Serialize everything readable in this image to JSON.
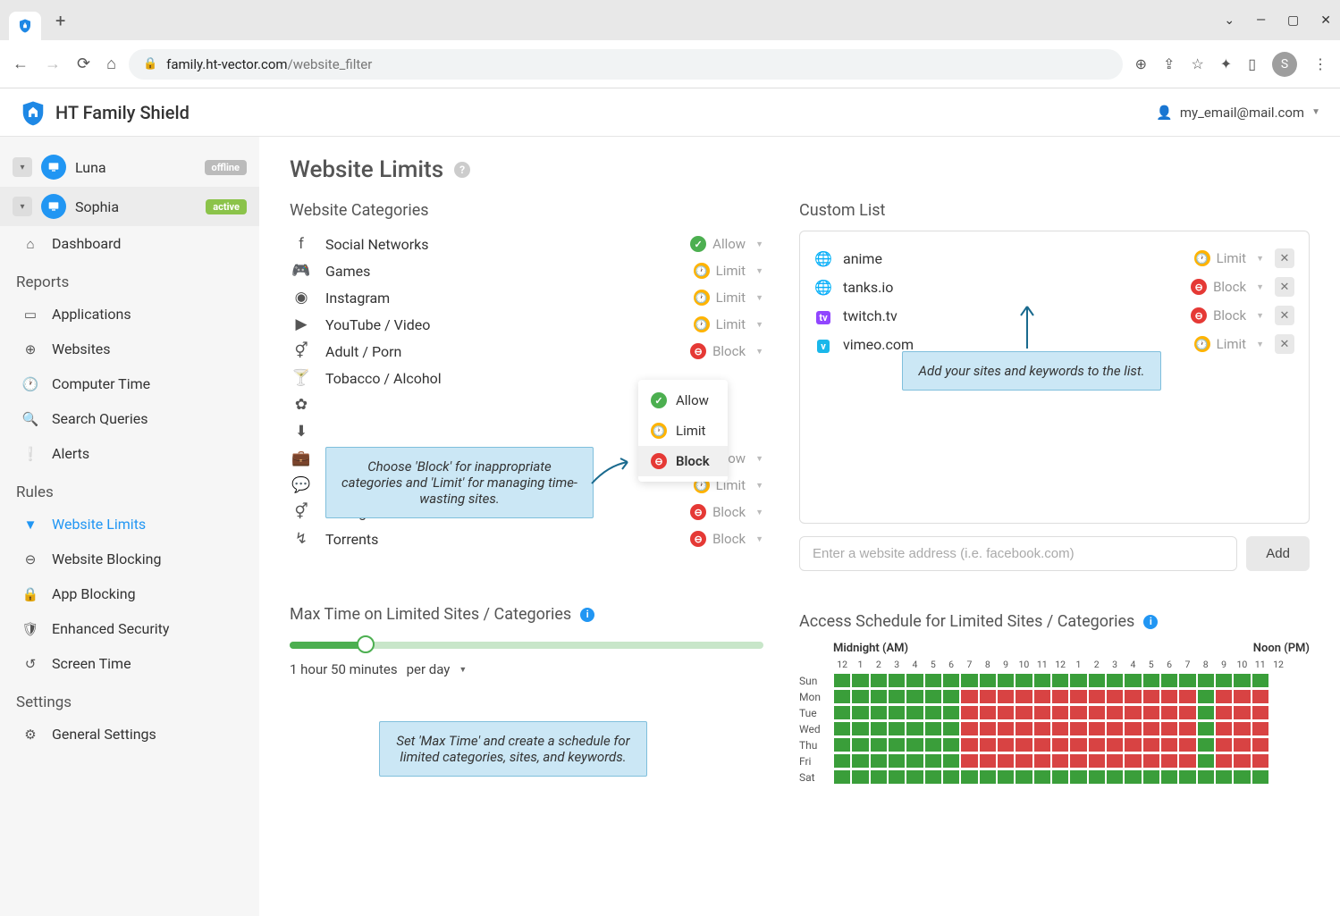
{
  "browser": {
    "url_domain": "family.ht-vector.com",
    "url_path": "/website_filter",
    "avatar_letter": "S"
  },
  "app": {
    "title": "HT Family Shield",
    "user_email": "my_email@mail.com"
  },
  "sidebar": {
    "profiles": [
      {
        "name": "Luna",
        "status": "offline"
      },
      {
        "name": "Sophia",
        "status": "active"
      }
    ],
    "sections": [
      {
        "items": [
          {
            "label": "Dashboard"
          }
        ]
      },
      {
        "title": "Reports",
        "items": [
          {
            "label": "Applications"
          },
          {
            "label": "Websites"
          },
          {
            "label": "Computer Time"
          },
          {
            "label": "Search Queries"
          },
          {
            "label": "Alerts"
          }
        ]
      },
      {
        "title": "Rules",
        "items": [
          {
            "label": "Website Limits",
            "selected": true
          },
          {
            "label": "Website Blocking"
          },
          {
            "label": "App Blocking"
          },
          {
            "label": "Enhanced Security"
          },
          {
            "label": "Screen Time"
          }
        ]
      },
      {
        "title": "Settings",
        "items": [
          {
            "label": "General Settings"
          }
        ]
      }
    ]
  },
  "page": {
    "title": "Website Limits",
    "categories_title": "Website Categories",
    "categories": [
      {
        "name": "Social Networks",
        "action": "Allow"
      },
      {
        "name": "Games",
        "action": "Limit"
      },
      {
        "name": "Instagram",
        "action": "Limit"
      },
      {
        "name": "YouTube / Video",
        "action": "Limit"
      },
      {
        "name": "Adult / Porn",
        "action": "Block",
        "dropdown_open": true
      },
      {
        "name": "Tobacco / Alcohol",
        "action": ""
      },
      {
        "name": "",
        "action": ""
      },
      {
        "name": "",
        "action": ""
      },
      {
        "name": "",
        "action": "Allow"
      },
      {
        "name": "Chat sites",
        "action": "Limit"
      },
      {
        "name": "Dating",
        "action": "Block"
      },
      {
        "name": "Torrents",
        "action": "Block"
      }
    ],
    "dropdown_options": [
      "Allow",
      "Limit",
      "Block"
    ],
    "custom_title": "Custom List",
    "custom_items": [
      {
        "name": "anime",
        "action": "Limit",
        "icon": "globe"
      },
      {
        "name": "tanks.io",
        "action": "Block",
        "icon": "globe"
      },
      {
        "name": "twitch.tv",
        "action": "Block",
        "icon": "twitch"
      },
      {
        "name": "vimeo.com",
        "action": "Limit",
        "icon": "vimeo"
      }
    ],
    "add_placeholder": "Enter a website address (i.e. facebook.com)",
    "add_button": "Add",
    "max_time_title": "Max Time on Limited Sites / Categories",
    "max_time_value": "1 hour 50 minutes",
    "max_time_period": "per day",
    "schedule_title": "Access Schedule for Limited Sites / Categories",
    "schedule_headers": [
      "Midnight (AM)",
      "Noon (PM)"
    ],
    "schedule_hours": [
      "12",
      "1",
      "2",
      "3",
      "4",
      "5",
      "6",
      "7",
      "8",
      "9",
      "10",
      "11",
      "12",
      "1",
      "2",
      "3",
      "4",
      "5",
      "6",
      "7",
      "8",
      "9",
      "10",
      "11",
      "12"
    ],
    "schedule_days": [
      "Sun",
      "Mon",
      "Tue",
      "Wed",
      "Thu",
      "Fri",
      "Sat"
    ],
    "callouts": {
      "categories": "Choose 'Block' for inappropriate categories and 'Limit' for managing time-wasting sites.",
      "custom": "Add your sites and keywords to the list.",
      "maxtime": "Set 'Max Time' and create a schedule for limited categories, sites, and keywords."
    }
  },
  "chart_data": {
    "type": "heatmap",
    "title": "Access Schedule for Limited Sites / Categories",
    "x_categories_hours_0_to_23": true,
    "y_categories": [
      "Sun",
      "Mon",
      "Tue",
      "Wed",
      "Thu",
      "Fri",
      "Sat"
    ],
    "legend": {
      "on": "allowed (green)",
      "off": "blocked (red)"
    },
    "grid": [
      [
        1,
        1,
        1,
        1,
        1,
        1,
        1,
        1,
        1,
        1,
        1,
        1,
        1,
        1,
        1,
        1,
        1,
        1,
        1,
        1,
        1,
        1,
        1,
        1
      ],
      [
        1,
        1,
        1,
        1,
        1,
        1,
        1,
        0,
        0,
        0,
        0,
        0,
        0,
        0,
        0,
        0,
        0,
        0,
        0,
        0,
        1,
        0,
        0,
        0
      ],
      [
        1,
        1,
        1,
        1,
        1,
        1,
        1,
        0,
        0,
        0,
        0,
        0,
        0,
        0,
        0,
        0,
        0,
        0,
        0,
        0,
        1,
        0,
        0,
        0
      ],
      [
        1,
        1,
        1,
        1,
        1,
        1,
        1,
        0,
        0,
        0,
        0,
        0,
        0,
        0,
        0,
        0,
        0,
        0,
        0,
        0,
        1,
        0,
        0,
        0
      ],
      [
        1,
        1,
        1,
        1,
        1,
        1,
        1,
        0,
        0,
        0,
        0,
        0,
        0,
        0,
        0,
        0,
        0,
        0,
        0,
        0,
        1,
        0,
        0,
        0
      ],
      [
        1,
        1,
        1,
        1,
        1,
        1,
        1,
        0,
        0,
        0,
        0,
        0,
        0,
        0,
        0,
        0,
        0,
        0,
        0,
        0,
        1,
        0,
        0,
        0
      ],
      [
        1,
        1,
        1,
        1,
        1,
        1,
        1,
        1,
        1,
        1,
        1,
        1,
        1,
        1,
        1,
        1,
        1,
        1,
        1,
        1,
        1,
        1,
        1,
        1
      ]
    ]
  }
}
